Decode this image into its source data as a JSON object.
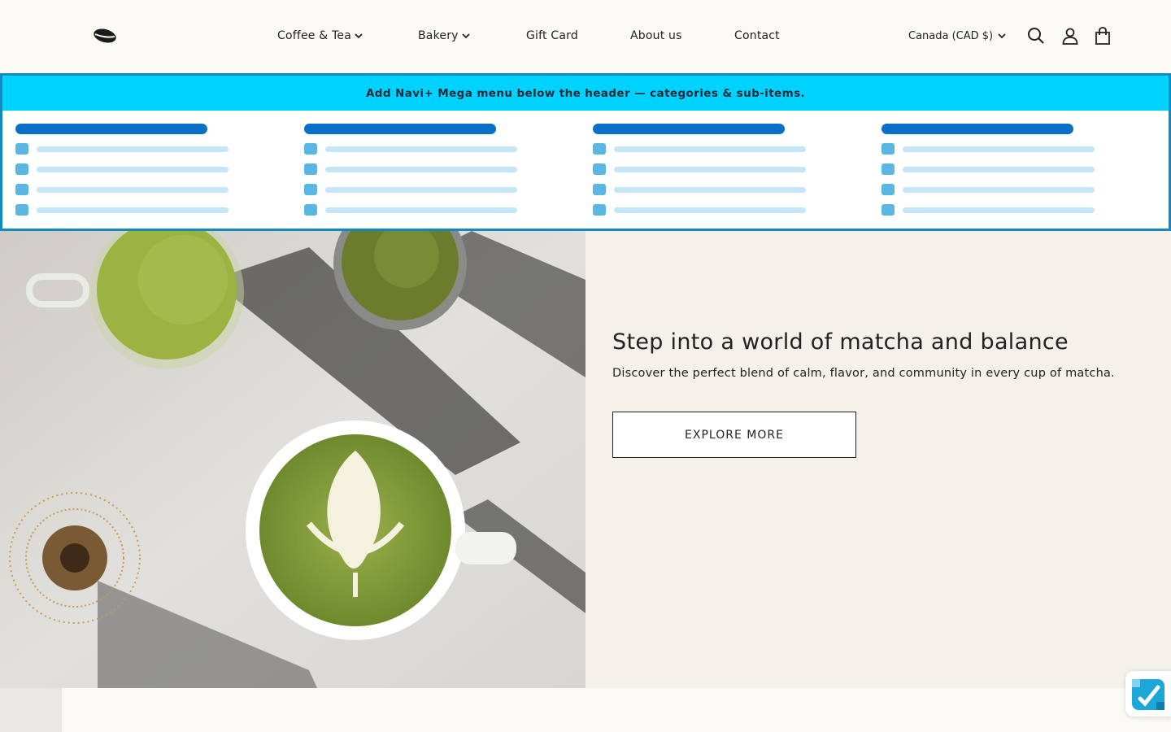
{
  "header": {
    "logo_icon": "coffee-bean-icon",
    "nav": [
      {
        "label": "Coffee & Tea",
        "has_dropdown": true
      },
      {
        "label": "Bakery",
        "has_dropdown": true
      },
      {
        "label": "Gift Card",
        "has_dropdown": false
      },
      {
        "label": "About us",
        "has_dropdown": false
      },
      {
        "label": "Contact",
        "has_dropdown": false
      }
    ],
    "country_selector": "Canada (CAD $)",
    "icons": [
      "search-icon",
      "account-icon",
      "cart-icon"
    ]
  },
  "mega_menu": {
    "banner_text": "Add Navi+ Mega menu below the header — categories & sub-items.",
    "banner_color": "#00d2ff",
    "columns": 4,
    "items_per_column": 4
  },
  "hero": {
    "title": "Step into a world of matcha and balance",
    "subtitle": "Discover the perfect blend of calm, flavor, and community in every cup of matcha.",
    "button_label": "EXPLORE MORE"
  },
  "widget": {
    "icon": "accessibility-hand-icon"
  }
}
